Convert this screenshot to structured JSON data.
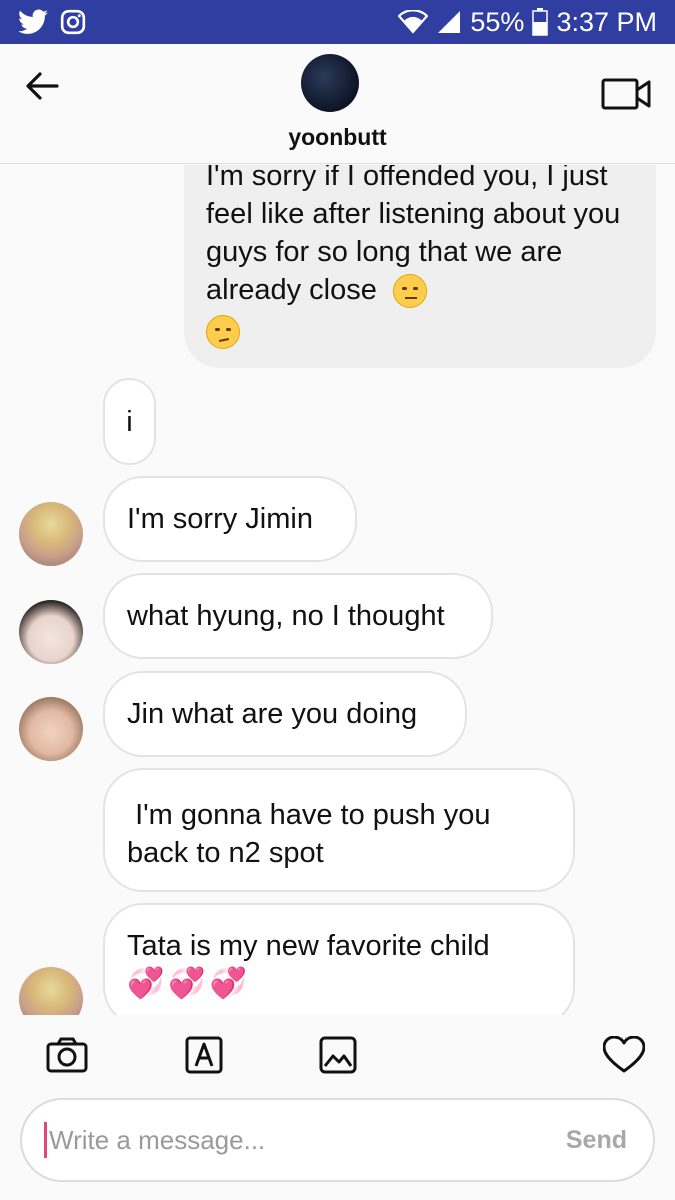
{
  "status_bar": {
    "battery": "55%",
    "time": "3:37 PM",
    "icons_left": [
      "twitter-icon",
      "instagram-icon"
    ],
    "icons_right": [
      "wifi-icon",
      "cell-signal-icon",
      "battery-icon"
    ],
    "bg_color": "#2f3ea0"
  },
  "header": {
    "username": "yoonbutt",
    "back_icon": "back-arrow-icon",
    "video_icon": "video-camera-icon"
  },
  "messages": [
    {
      "direction": "outgoing",
      "text": "I'm sorry if I offended you, I just feel like after listening about you guys for so long that we are already close",
      "emojis": [
        "pensive-face",
        "worried-face"
      ]
    },
    {
      "direction": "incoming",
      "text": "i"
    },
    {
      "direction": "incoming",
      "text": "I'm sorry Jimin"
    },
    {
      "direction": "incoming",
      "text": "what hyung, no I thought"
    },
    {
      "direction": "incoming",
      "text": "Jin what are you doing"
    },
    {
      "direction": "incoming",
      "text": " I'm gonna have to push you back to n2 spot"
    },
    {
      "direction": "incoming",
      "text": "Tata is my new favorite child",
      "emojis": [
        "two-hearts",
        "two-hearts",
        "two-hearts"
      ]
    }
  ],
  "toolbar": {
    "icons": [
      "camera-icon",
      "sticker-icon",
      "gallery-icon",
      "heart-icon"
    ]
  },
  "composer": {
    "placeholder": "Write a message...",
    "send_label": "Send"
  }
}
